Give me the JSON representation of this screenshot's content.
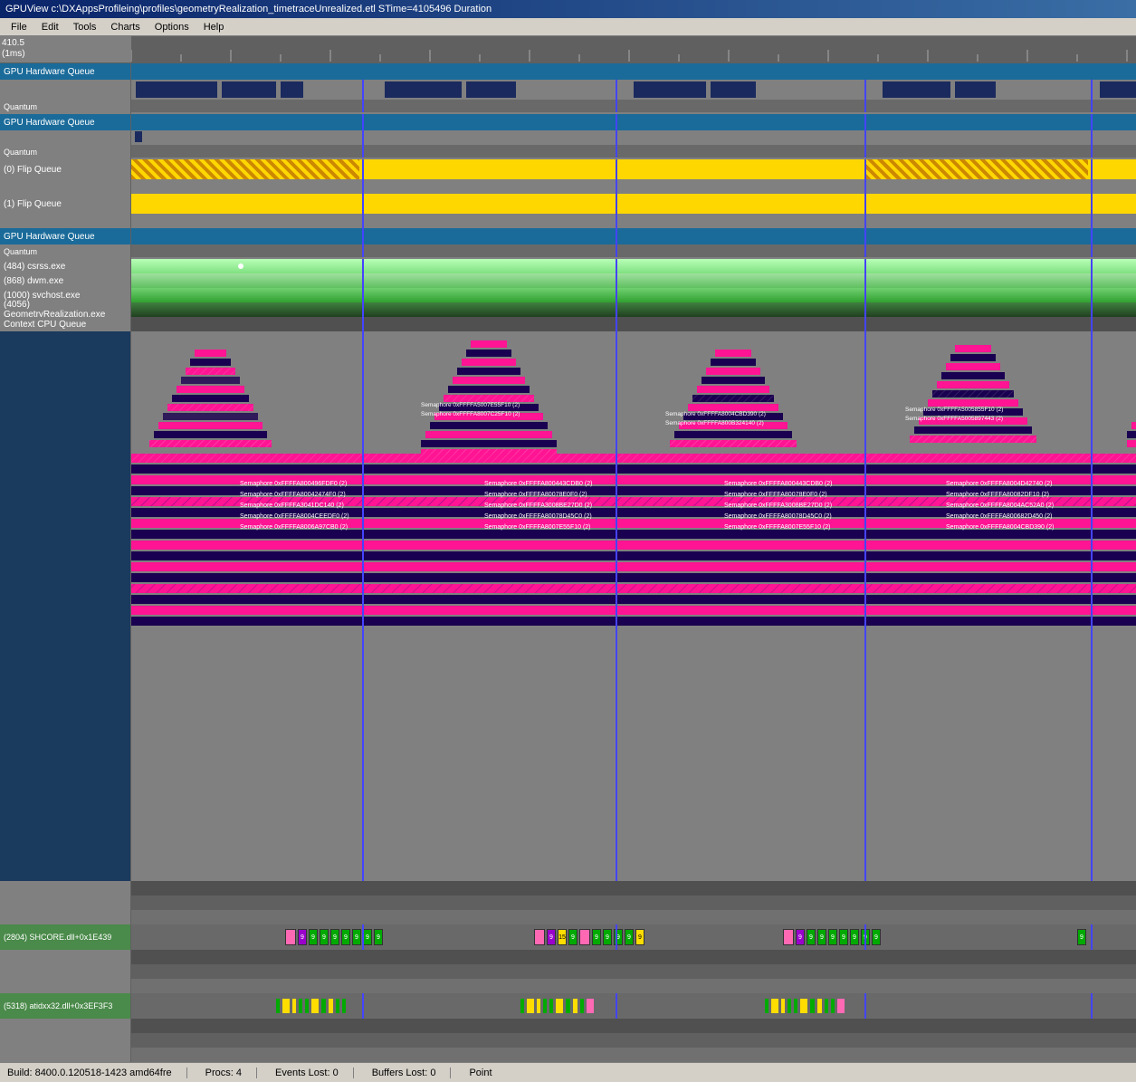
{
  "titlebar": {
    "text": "GPUView c:\\DXAppsProfileing\\profiles\\geometryRealization_timetraceUnrealized.etl STime=4105496 Duration"
  },
  "menubar": {
    "items": [
      "File",
      "Edit",
      "Tools",
      "Charts",
      "Options",
      "Help"
    ]
  },
  "timeline": {
    "time_label": "410.5",
    "unit_label": "(1ms)"
  },
  "tracks": {
    "gpu_hw_queue": "GPU Hardware Queue",
    "quantum": "Quantum",
    "flip_queue_0": "(0) Flip Queue",
    "flip_queue_1": "(1) Flip Queue",
    "processes": [
      "(484) csrss.exe",
      "(868) dwm.exe",
      "(1000) svchost.exe",
      "(4056) GeometryRealization.exe",
      "Context CPU Queue"
    ],
    "threads": [
      "(2804) SHCORE.dll+0x1E439",
      "(5318) atidxx32.dll+0x3EF3F3"
    ]
  },
  "semaphores": [
    "Semaphore 0xFFFFA5007E55F10 (2)",
    "Semaphore 0xFFFFA8007C25F10 (2)",
    "Semaphore 0xFFFFA800496FDF0 (2)",
    "Semaphore 0xFFFFA80042474F0 (2)",
    "Semaphore 0xFFFFA3041DC140 (2)",
    "Semaphore 0xFFFFA8004CEEDF0 (2)",
    "Semaphore 0xFFFFA8006A97CB0 (2)",
    "Semaphore 0xFFFFA8004CBD390 (2)",
    "Semaphore 0xFFFFA800B324140 (2)",
    "Semaphore 0xFFFFA800443CDB0 (2)",
    "Semaphore 0xFFFFA80078E0F0 (2)",
    "Semaphore 0xFFFFA3008BE27D0 (2)",
    "Semaphore 0xFFFFA80078D45C0 (2)",
    "Semaphore 0xFFFFA8007E55F10 (2)"
  ],
  "statusbar": {
    "build": "Build: 8400.0.120518-1423  amd64fre",
    "procs": "Procs: 4",
    "events_lost": "Events Lost: 0",
    "buffers_lost": "Buffers Lost: 0",
    "point": "Point"
  },
  "colors": {
    "background": "#808080",
    "navy_activity": "#1a2a5e",
    "gpu_hw_header": "#1a6b9a",
    "flip_yellow": "#ffd700",
    "flip_orange": "#cc8800",
    "green_light": "#90ee90",
    "green_dark": "#206020",
    "blue_viz": "#1a3a5e",
    "pink_magenta": "#ff00aa",
    "blue_line": "#4444ff",
    "accent_pink": "#ff1493"
  }
}
